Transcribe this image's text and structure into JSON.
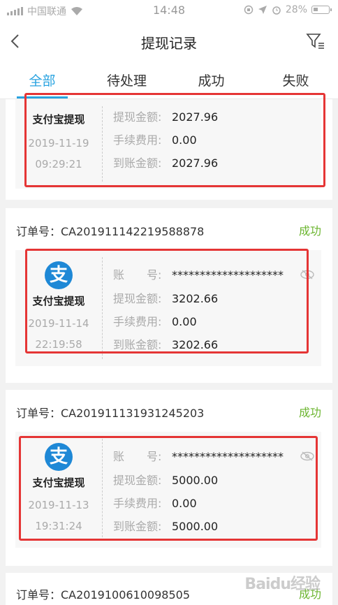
{
  "status": {
    "carrier": "中国联通",
    "time": "14:48",
    "battery": "28%"
  },
  "header": {
    "title": "提现记录"
  },
  "tabs": [
    "全部",
    "待处理",
    "成功",
    "失败"
  ],
  "labels": {
    "account": "账　　号:",
    "withdraw": "提现金额:",
    "fee": "手续费用:",
    "arrive": "到账金额:"
  },
  "records": [
    {
      "method": "支付宝提现",
      "date": "2019-11-19",
      "time": "09:29:21",
      "withdraw": "2027.96",
      "fee": "0.00",
      "arrive": "2027.96"
    },
    {
      "order": "订单号：CA2019111422195888​78",
      "state": "成功",
      "method": "支付宝提现",
      "date": "2019-11-14",
      "time": "22:19:58",
      "account": "********************",
      "withdraw": "3202.66",
      "fee": "0.00",
      "arrive": "3202.66"
    },
    {
      "order": "订单号：CA201911131931245203",
      "state": "成功",
      "method": "支付宝提现",
      "date": "2019-11-13",
      "time": "19:31:24",
      "account": "********************",
      "withdraw": "5000.00",
      "fee": "0.00",
      "arrive": "5000.00"
    },
    {
      "order": "订单号：CA20191006100985​05",
      "state": "成功"
    }
  ],
  "logo_char": "支",
  "watermark": "Baidu经验",
  "colors": {
    "accent": "#29a3e0",
    "success": "#6bb52f",
    "highlight": "#e53535",
    "alipay": "#1e88d6"
  }
}
